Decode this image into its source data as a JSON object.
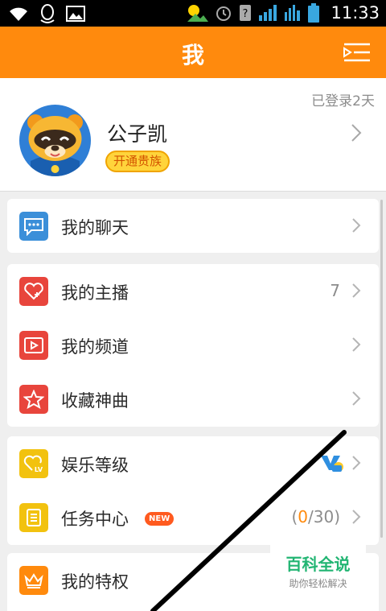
{
  "status_bar": {
    "time": "11:33"
  },
  "header": {
    "title": "我"
  },
  "profile": {
    "login_days": "已登录2天",
    "username": "公子凯",
    "vip_button": "开通贵族"
  },
  "card_chat": {
    "items": [
      {
        "label": "我的聊天",
        "icon": "chat-icon",
        "color": "#3b8fd9"
      }
    ]
  },
  "card_content": {
    "items": [
      {
        "label": "我的主播",
        "value": "7",
        "icon": "heart-plus-icon",
        "color": "#e8453c"
      },
      {
        "label": "我的频道",
        "icon": "video-play-icon",
        "color": "#e8453c"
      },
      {
        "label": "收藏神曲",
        "icon": "star-icon",
        "color": "#e8453c"
      }
    ]
  },
  "card_level": {
    "items": [
      {
        "label": "娱乐等级",
        "icon": "heart-lv-icon",
        "color": "#f2c20f"
      },
      {
        "label": "任务中心",
        "badge": "NEW",
        "value_open": "(",
        "value_done": "0",
        "value_rest": "/30)",
        "icon": "task-list-icon",
        "color": "#f2c20f"
      }
    ]
  },
  "card_privilege": {
    "items": [
      {
        "label": "我的特权",
        "icon": "crown-icon",
        "color": "#ff8a0d"
      }
    ]
  },
  "watermark": {
    "main": "百科全说",
    "sub": "助你轻松解决"
  },
  "colors": {
    "accent": "#ff8a0d",
    "blue": "#3b8fd9",
    "red": "#e8453c",
    "yellow": "#f2c20f",
    "green": "#22b573"
  }
}
